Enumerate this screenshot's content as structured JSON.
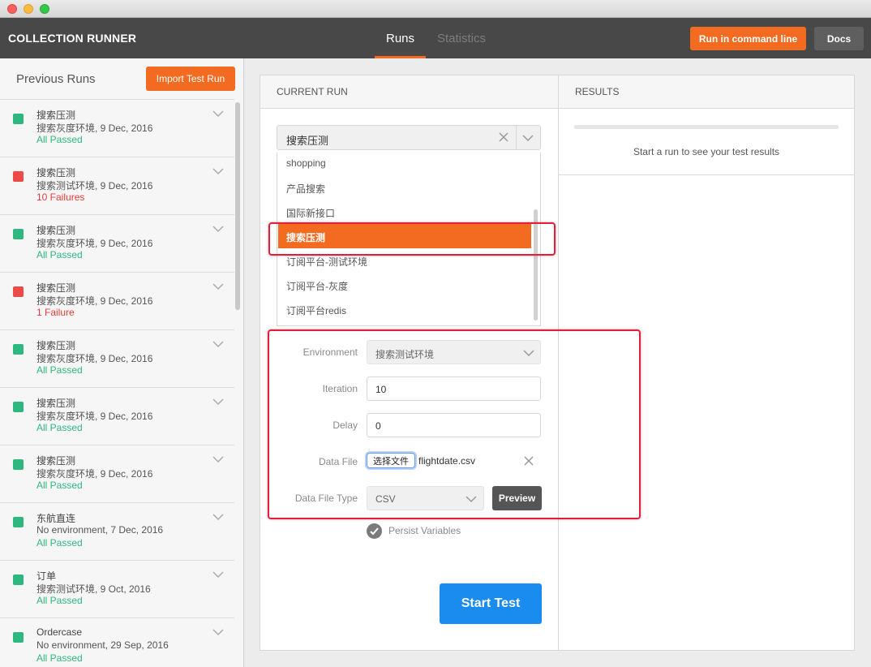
{
  "app": {
    "title": "COLLECTION RUNNER",
    "tabs": [
      {
        "label": "Runs",
        "active": true
      },
      {
        "label": "Statistics",
        "active": false
      }
    ],
    "run_cmd_label": "Run in command line",
    "docs_label": "Docs",
    "accent_color": "#f26b21"
  },
  "sidebar": {
    "title": "Previous Runs",
    "import_label": "Import Test Run",
    "runs": [
      {
        "name": "搜索压测",
        "meta": "搜索灰度环境, 9 Dec, 2016",
        "result": "All Passed",
        "status": "pass"
      },
      {
        "name": "搜索压测",
        "meta": "搜索测试环境, 9 Dec, 2016",
        "result": "10 Failures",
        "status": "fail"
      },
      {
        "name": "搜索压测",
        "meta": "搜索灰度环境, 9 Dec, 2016",
        "result": "All Passed",
        "status": "pass"
      },
      {
        "name": "搜索压测",
        "meta": "搜索灰度环境, 9 Dec, 2016",
        "result": "1 Failure",
        "status": "fail"
      },
      {
        "name": "搜索压测",
        "meta": "搜索灰度环境, 9 Dec, 2016",
        "result": "All Passed",
        "status": "pass"
      },
      {
        "name": "搜索压测",
        "meta": "搜索灰度环境, 9 Dec, 2016",
        "result": "All Passed",
        "status": "pass"
      },
      {
        "name": "搜索压测",
        "meta": "搜索灰度环境, 9 Dec, 2016",
        "result": "All Passed",
        "status": "pass"
      },
      {
        "name": "东航直连",
        "meta": "No environment, 7 Dec, 2016",
        "result": "All Passed",
        "status": "pass"
      },
      {
        "name": "订单",
        "meta": "搜索测试环境, 9 Oct, 2016",
        "result": "All Passed",
        "status": "pass"
      },
      {
        "name": "Ordercase",
        "meta": "No environment, 29 Sep, 2016",
        "result": "All Passed",
        "status": "pass"
      }
    ]
  },
  "current_run": {
    "header": "CURRENT RUN",
    "collection": {
      "value": "搜索压测",
      "options": [
        "shopping",
        "产品搜索",
        "国际新接口",
        "搜索压测",
        "订阅平台-测试环境",
        "订阅平台-灰度",
        "订阅平台redis"
      ],
      "selected_index": 3
    },
    "environment": {
      "label": "Environment",
      "value": "搜索测试环境"
    },
    "iteration": {
      "label": "Iteration",
      "value": "10"
    },
    "delay": {
      "label": "Delay",
      "value": "0"
    },
    "data_file": {
      "label": "Data File",
      "button": "选择文件",
      "file": "flightdate.csv"
    },
    "data_file_type": {
      "label": "Data File Type",
      "value": "CSV",
      "preview_label": "Preview"
    },
    "persist": {
      "label": "Persist Variables",
      "checked": true
    },
    "start_label": "Start Test"
  },
  "results": {
    "header": "RESULTS",
    "empty_text": "Start a run to see your test results"
  }
}
